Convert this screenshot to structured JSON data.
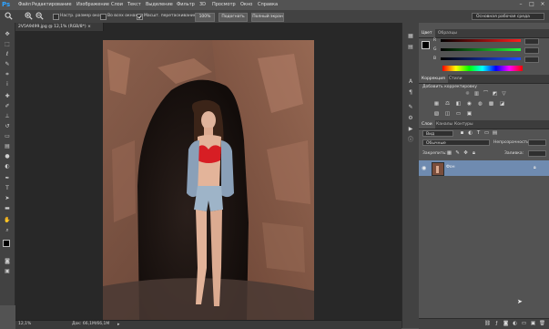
{
  "app": {
    "logo": "Ps"
  },
  "menu": [
    "Файл",
    "Редактирование",
    "Изображение",
    "Слои",
    "Текст",
    "Выделение",
    "Фильтр",
    "3D",
    "Просмотр",
    "Окно",
    "Справка"
  ],
  "window_controls": {
    "minimize": "–",
    "maximize": "□",
    "close": "×"
  },
  "options": {
    "resize_windows": "Настр. размер окон",
    "all_windows": "Во всех окнах",
    "scrubby_zoom": "Масшт. перетаскиванием",
    "zoom_100": "100%",
    "fit_screen": "Подогнать",
    "fill_screen": "Полный экран",
    "workspace": "Основная рабочая среда"
  },
  "document": {
    "tab_title": "2V5A9499.jpg @ 12,1% (RGB/8*) ×",
    "zoom": "12,1%",
    "doc_size": "Док: 66,1M/66,1M"
  },
  "color_panel": {
    "tabs": [
      "Цвет",
      "Образцы"
    ],
    "channels": [
      "R",
      "G",
      "B"
    ],
    "colors": {
      "red": "#d83a3a",
      "green": "#3fb03f",
      "blue": "#3b5fd8"
    }
  },
  "adjustments_panel": {
    "tabs": [
      "Коррекция",
      "Стили"
    ],
    "heading": "Добавить корректировку"
  },
  "layers_panel": {
    "tabs": [
      "Слои",
      "Каналы",
      "Контуры"
    ],
    "kind_filter": "Вид",
    "blend_mode": "Обычные",
    "opacity_label": "Непрозрачность:",
    "lock_label": "Закрепить:",
    "fill_label": "Заливка:",
    "layer_name": "Фон"
  },
  "icons": {
    "zoom": "zoom-icon",
    "zoom_in": "zoom-in-icon",
    "zoom_out": "zoom-out-icon"
  }
}
